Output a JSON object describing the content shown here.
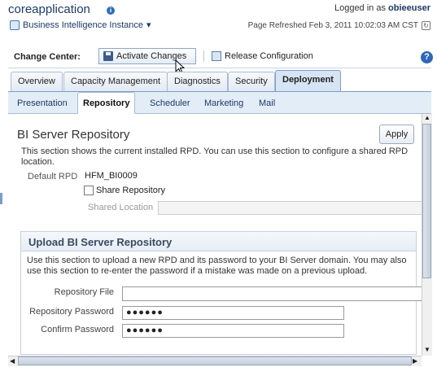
{
  "header": {
    "app_title": "coreapplication",
    "info_icon": "info-icon",
    "logged_in_prefix": "Logged in as",
    "username": "obieeuser",
    "bi_instance": "Business Intelligence Instance",
    "refreshed": "Page Refreshed Feb 3, 2011 10:02:03 AM CST"
  },
  "change_center": {
    "label": "Change Center:",
    "activate_label": "Activate Changes",
    "release_label": "Release Configuration"
  },
  "tabs": {
    "main": [
      "Overview",
      "Capacity Management",
      "Diagnostics",
      "Security",
      "Deployment"
    ],
    "active_main": "Deployment",
    "sub": [
      "Presentation",
      "Repository",
      "Scheduler",
      "Marketing",
      "Mail"
    ],
    "active_sub": "Repository"
  },
  "repository": {
    "title": "BI Server Repository",
    "apply_label": "Apply",
    "description": "This section shows the current installed RPD. You can use this section to configure a shared RPD location.",
    "default_rpd_label": "Default RPD",
    "default_rpd_value": "HFM_BI0009",
    "share_label": "Share Repository",
    "shared_location_label": "Shared Location"
  },
  "upload": {
    "title": "Upload BI Server Repository",
    "description": "Use this section to upload a new RPD and its password to your BI Server domain. You may also use this section to re-enter the password if a mistake was made on a previous upload.",
    "repo_file_label": "Repository File",
    "repo_pw_label": "Repository Password",
    "repo_pw_value": "●●●●●●",
    "confirm_pw_label": "Confirm Password",
    "confirm_pw_value": "●●●●●●"
  }
}
